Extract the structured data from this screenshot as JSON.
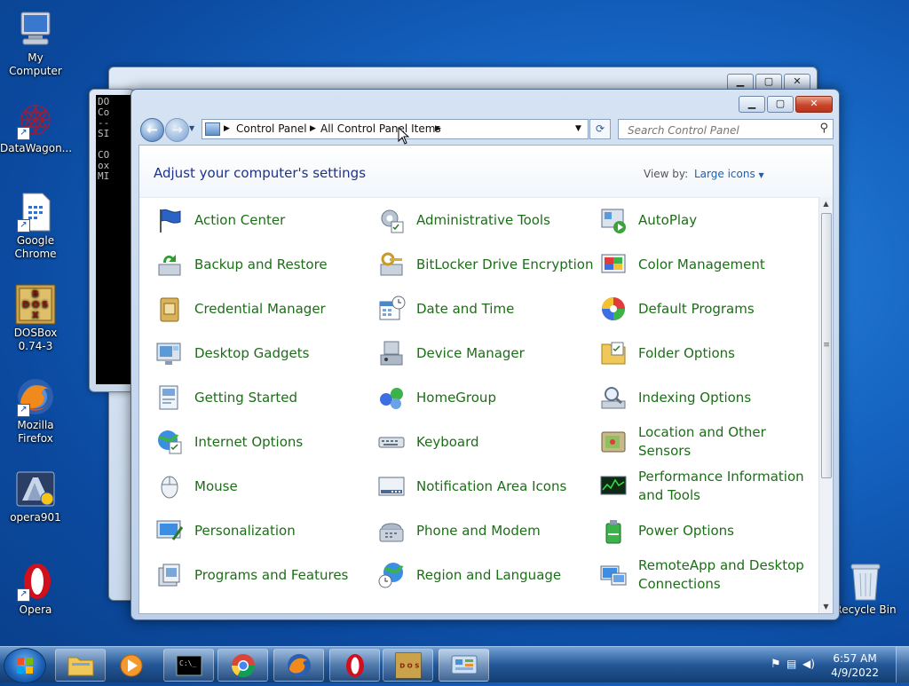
{
  "desktop": {
    "icons": [
      {
        "label": "My Computer"
      },
      {
        "label": "DataWagon..."
      },
      {
        "label": "Google Chrome"
      },
      {
        "label": "DOSBox 0.74-3"
      },
      {
        "label": "Mozilla Firefox"
      },
      {
        "label": "opera901"
      },
      {
        "label": "Opera"
      },
      {
        "label": "Recycle Bin"
      }
    ]
  },
  "console": {
    "lines": [
      "DO",
      "Co",
      "--",
      "SI",
      "",
      "CO",
      "ox",
      "MI"
    ]
  },
  "window": {
    "title": "All Control Panel Items",
    "address": {
      "segments": [
        "Control Panel",
        "All Control Panel Items"
      ]
    },
    "search": {
      "placeholder": "Search Control Panel"
    },
    "heading": "Adjust your computer's settings",
    "view_by_label": "View by:",
    "view_by_value": "Large icons",
    "items": [
      {
        "label": "Action Center",
        "icon": "flag-icon"
      },
      {
        "label": "Administrative Tools",
        "icon": "admin-tools-icon"
      },
      {
        "label": "AutoPlay",
        "icon": "autoplay-icon"
      },
      {
        "label": "Backup and Restore",
        "icon": "backup-icon"
      },
      {
        "label": "BitLocker Drive Encryption",
        "icon": "bitlocker-icon"
      },
      {
        "label": "Color Management",
        "icon": "color-management-icon"
      },
      {
        "label": "Credential Manager",
        "icon": "credential-icon"
      },
      {
        "label": "Date and Time",
        "icon": "calendar-clock-icon"
      },
      {
        "label": "Default Programs",
        "icon": "default-programs-icon"
      },
      {
        "label": "Desktop Gadgets",
        "icon": "gadgets-icon"
      },
      {
        "label": "Device Manager",
        "icon": "device-manager-icon"
      },
      {
        "label": "Folder Options",
        "icon": "folder-options-icon"
      },
      {
        "label": "Getting Started",
        "icon": "getting-started-icon"
      },
      {
        "label": "HomeGroup",
        "icon": "homegroup-icon"
      },
      {
        "label": "Indexing Options",
        "icon": "indexing-icon"
      },
      {
        "label": "Internet Options",
        "icon": "internet-options-icon"
      },
      {
        "label": "Keyboard",
        "icon": "keyboard-icon"
      },
      {
        "label": "Location and Other Sensors",
        "icon": "sensors-icon"
      },
      {
        "label": "Mouse",
        "icon": "mouse-icon"
      },
      {
        "label": "Notification Area Icons",
        "icon": "notification-icon"
      },
      {
        "label": "Performance Information and Tools",
        "icon": "performance-icon"
      },
      {
        "label": "Personalization",
        "icon": "personalization-icon"
      },
      {
        "label": "Phone and Modem",
        "icon": "phone-icon"
      },
      {
        "label": "Power Options",
        "icon": "power-icon"
      },
      {
        "label": "Programs and Features",
        "icon": "programs-icon"
      },
      {
        "label": "Region and Language",
        "icon": "globe-clock-icon"
      },
      {
        "label": "RemoteApp and Desktop Connections",
        "icon": "remoteapp-icon"
      }
    ]
  },
  "taskbar": {
    "apps": [
      "start-button",
      "explorer",
      "media-player",
      "command-prompt",
      "chrome",
      "firefox",
      "opera",
      "dosbox",
      "control-panel"
    ],
    "clock": {
      "time": "6:57 AM",
      "date": "4/9/2022"
    }
  },
  "colors": {
    "accent": "#1c6e17",
    "heading": "#1e3287",
    "link": "#1a5fb4"
  }
}
